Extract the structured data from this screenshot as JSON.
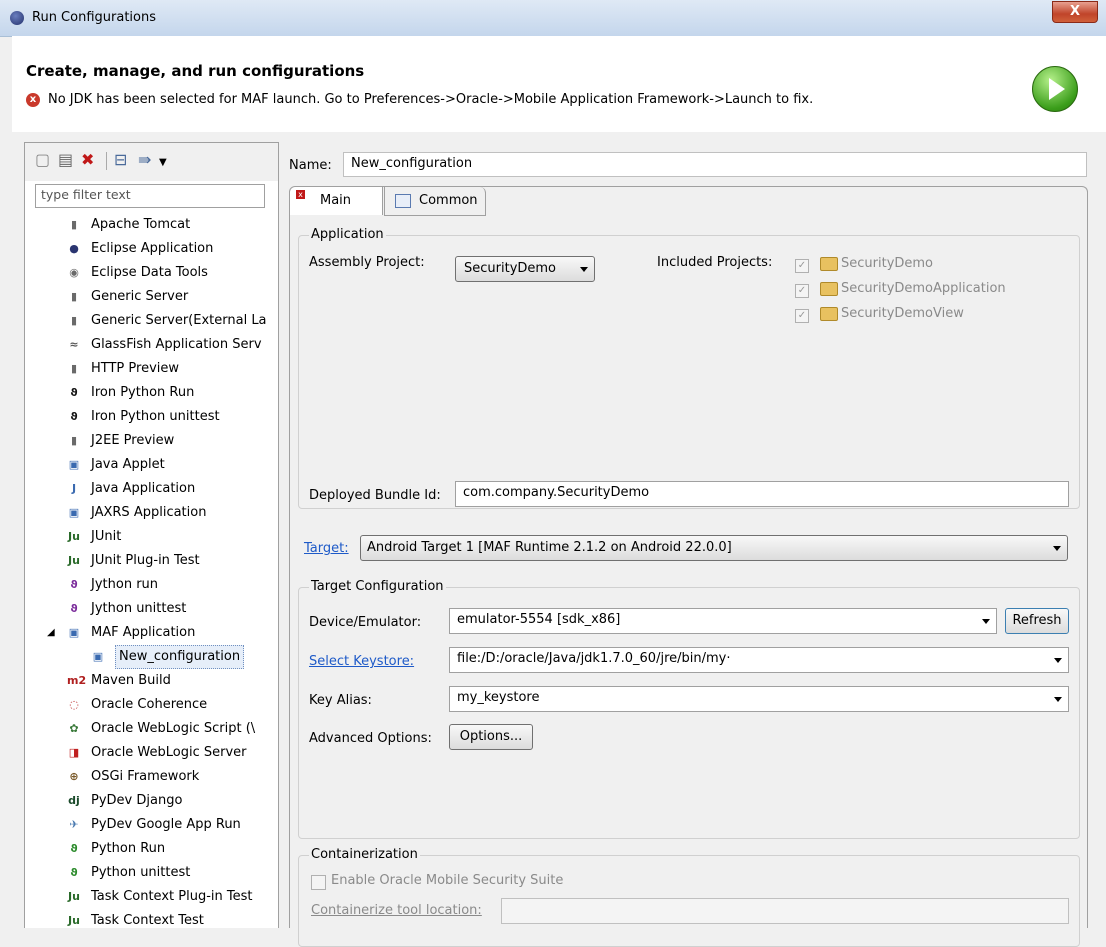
{
  "window": {
    "title": "Run Configurations",
    "close_label": "X"
  },
  "header": {
    "heading": "Create, manage, and run configurations",
    "error_message": "No JDK has been selected for MAF launch. Go to Preferences->Oracle->Mobile Application Framework->Launch to fix.",
    "error_glyph": "x"
  },
  "toolbar": {
    "new_icon": "new-config-icon",
    "duplicate_icon": "duplicate-icon",
    "delete_icon": "delete-icon",
    "collapse_icon": "collapse-all-icon",
    "filter_icon": "filter-icon"
  },
  "filter": {
    "placeholder": "type filter text"
  },
  "tree": [
    {
      "label": "Apache Tomcat",
      "icon": "server-icon",
      "glyph": "▮",
      "color": "#6a6a6a"
    },
    {
      "label": "Eclipse Application",
      "icon": "eclipse-icon",
      "glyph": "●",
      "color": "#2a3570"
    },
    {
      "label": "Eclipse Data Tools",
      "icon": "database-icon",
      "glyph": "◉",
      "color": "#6a6a6a"
    },
    {
      "label": "Generic Server",
      "icon": "server-icon",
      "glyph": "▮",
      "color": "#6a6a6a"
    },
    {
      "label": "Generic Server(External La",
      "icon": "server-icon",
      "glyph": "▮",
      "color": "#6a6a6a"
    },
    {
      "label": "GlassFish Application Serv",
      "icon": "glassfish-icon",
      "glyph": "≈",
      "color": "#5a5a5a"
    },
    {
      "label": "HTTP Preview",
      "icon": "server-icon",
      "glyph": "▮",
      "color": "#6a6a6a"
    },
    {
      "label": "Iron Python Run",
      "icon": "python-icon",
      "glyph": "ϑ",
      "color": "#111111"
    },
    {
      "label": "Iron Python unittest",
      "icon": "python-icon",
      "glyph": "ϑ",
      "color": "#111111"
    },
    {
      "label": "J2EE Preview",
      "icon": "server-icon",
      "glyph": "▮",
      "color": "#6a6a6a"
    },
    {
      "label": "Java Applet",
      "icon": "applet-icon",
      "glyph": "▣",
      "color": "#3a6ab0"
    },
    {
      "label": "Java Application",
      "icon": "java-app-icon",
      "glyph": "J",
      "color": "#3a6ab0"
    },
    {
      "label": "JAXRS Application",
      "icon": "jaxrs-icon",
      "glyph": "▣",
      "color": "#3a6ab0"
    },
    {
      "label": "JUnit",
      "icon": "junit-icon",
      "glyph": "Ju",
      "color": "#2a6a2a"
    },
    {
      "label": "JUnit Plug-in Test",
      "icon": "junit-icon",
      "glyph": "Ju",
      "color": "#2a6a2a"
    },
    {
      "label": "Jython run",
      "icon": "python-icon",
      "glyph": "ϑ",
      "color": "#7a2a9a"
    },
    {
      "label": "Jython unittest",
      "icon": "python-icon",
      "glyph": "ϑ",
      "color": "#7a2a9a"
    },
    {
      "label": "MAF Application",
      "icon": "maf-icon",
      "glyph": "▣",
      "color": "#3a6ab0",
      "expanded": "◢"
    },
    {
      "label": "New_configuration",
      "icon": "maf-config-icon",
      "glyph": "▣",
      "color": "#3a6ab0",
      "child": true,
      "selected": true
    },
    {
      "label": "Maven Build",
      "icon": "maven-icon",
      "glyph": "m2",
      "color": "#b02020"
    },
    {
      "label": "Oracle Coherence",
      "icon": "coherence-icon",
      "glyph": "◌",
      "color": "#c04040"
    },
    {
      "label": "Oracle WebLogic Script (\\",
      "icon": "weblogic-script-icon",
      "glyph": "✿",
      "color": "#3a7a3a"
    },
    {
      "label": "Oracle WebLogic Server",
      "icon": "weblogic-icon",
      "glyph": "◨",
      "color": "#c02020"
    },
    {
      "label": "OSGi Framework",
      "icon": "osgi-icon",
      "glyph": "⊕",
      "color": "#7a5a2a"
    },
    {
      "label": "PyDev Django",
      "icon": "django-icon",
      "glyph": "dj",
      "color": "#1a4a2a"
    },
    {
      "label": "PyDev Google App Run",
      "icon": "google-app-icon",
      "glyph": "✈",
      "color": "#4a7ab0"
    },
    {
      "label": "Python Run",
      "icon": "python-icon",
      "glyph": "ϑ",
      "color": "#2a8a2a"
    },
    {
      "label": "Python unittest",
      "icon": "python-icon",
      "glyph": "ϑ",
      "color": "#2a8a2a"
    },
    {
      "label": "Task Context Plug-in Test",
      "icon": "task-context-icon",
      "glyph": "Ju",
      "color": "#2a6a2a"
    },
    {
      "label": "Task Context Test",
      "icon": "task-context-icon",
      "glyph": "Ju",
      "color": "#2a6a2a"
    }
  ],
  "config": {
    "name_label": "Name:",
    "name_value": "New_configuration",
    "tabs": [
      {
        "label": "Main",
        "error_glyph": "x"
      },
      {
        "label": "Common"
      }
    ],
    "application": {
      "title": "Application",
      "assembly_label": "Assembly Project:",
      "assembly_value": "SecurityDemo",
      "included_label": "Included Projects:",
      "included_projects": [
        "SecurityDemo",
        "SecurityDemoApplication",
        "SecurityDemoView"
      ],
      "checked_glyph": "✓",
      "bundle_label": "Deployed Bundle Id:",
      "bundle_value": "com.company.SecurityDemo"
    },
    "target": {
      "link": "Target:",
      "value": "Android Target 1 [MAF Runtime 2.1.2 on Android 22.0.0]"
    },
    "target_config": {
      "title": "Target Configuration",
      "device_label": "Device/Emulator:",
      "device_value": "emulator-5554 [sdk_x86]",
      "refresh_label": "Refresh",
      "keystore_link": "Select Keystore:",
      "keystore_value": "file:/D:/oracle/Java/jdk1.7.0_60/jre/bin/my·",
      "alias_label": "Key Alias:",
      "alias_value": "my_keystore",
      "advanced_label": "Advanced Options:",
      "options_label": "Options..."
    },
    "containerization": {
      "title": "Containerization",
      "enable_label": "Enable Oracle Mobile Security Suite",
      "tool_link": "Containerize tool location:"
    }
  }
}
